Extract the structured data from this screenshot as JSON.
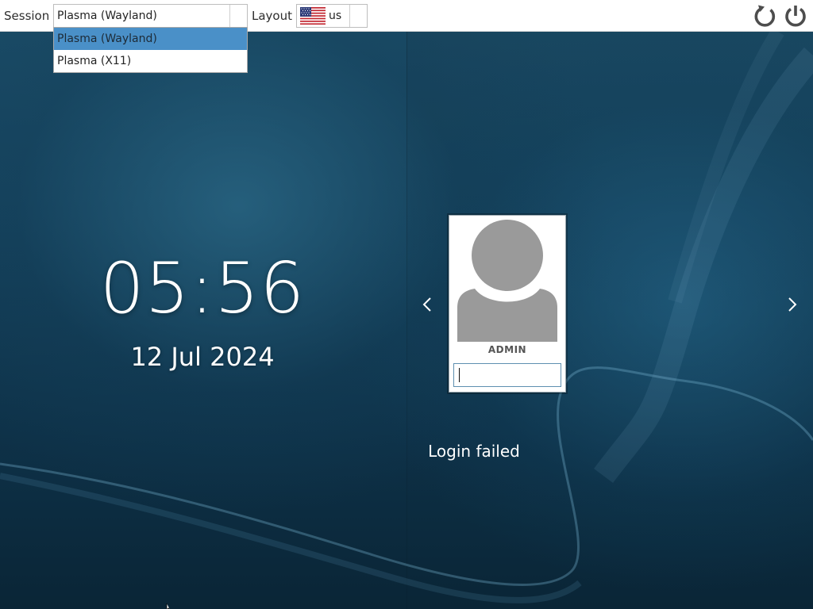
{
  "topbar": {
    "session_label": "Session",
    "session_selected": "Plasma (Wayland)",
    "session_options": [
      "Plasma (Wayland)",
      "Plasma (X11)"
    ],
    "layout_label": "Layout",
    "layout_value": "us",
    "layout_flag": "us-flag-icon"
  },
  "clock": {
    "time": "05:56",
    "date": "12 Jul 2024"
  },
  "user": {
    "name": "ADMIN",
    "password_value": ""
  },
  "status": {
    "message": "Login failed"
  },
  "icons": {
    "reboot": "reboot-icon",
    "power": "power-icon",
    "prev": "chevron-left-icon",
    "next": "chevron-right-icon"
  },
  "colors": {
    "selection": "#4a90c8",
    "background": "#15425d",
    "avatar": "#9a9a9a"
  }
}
